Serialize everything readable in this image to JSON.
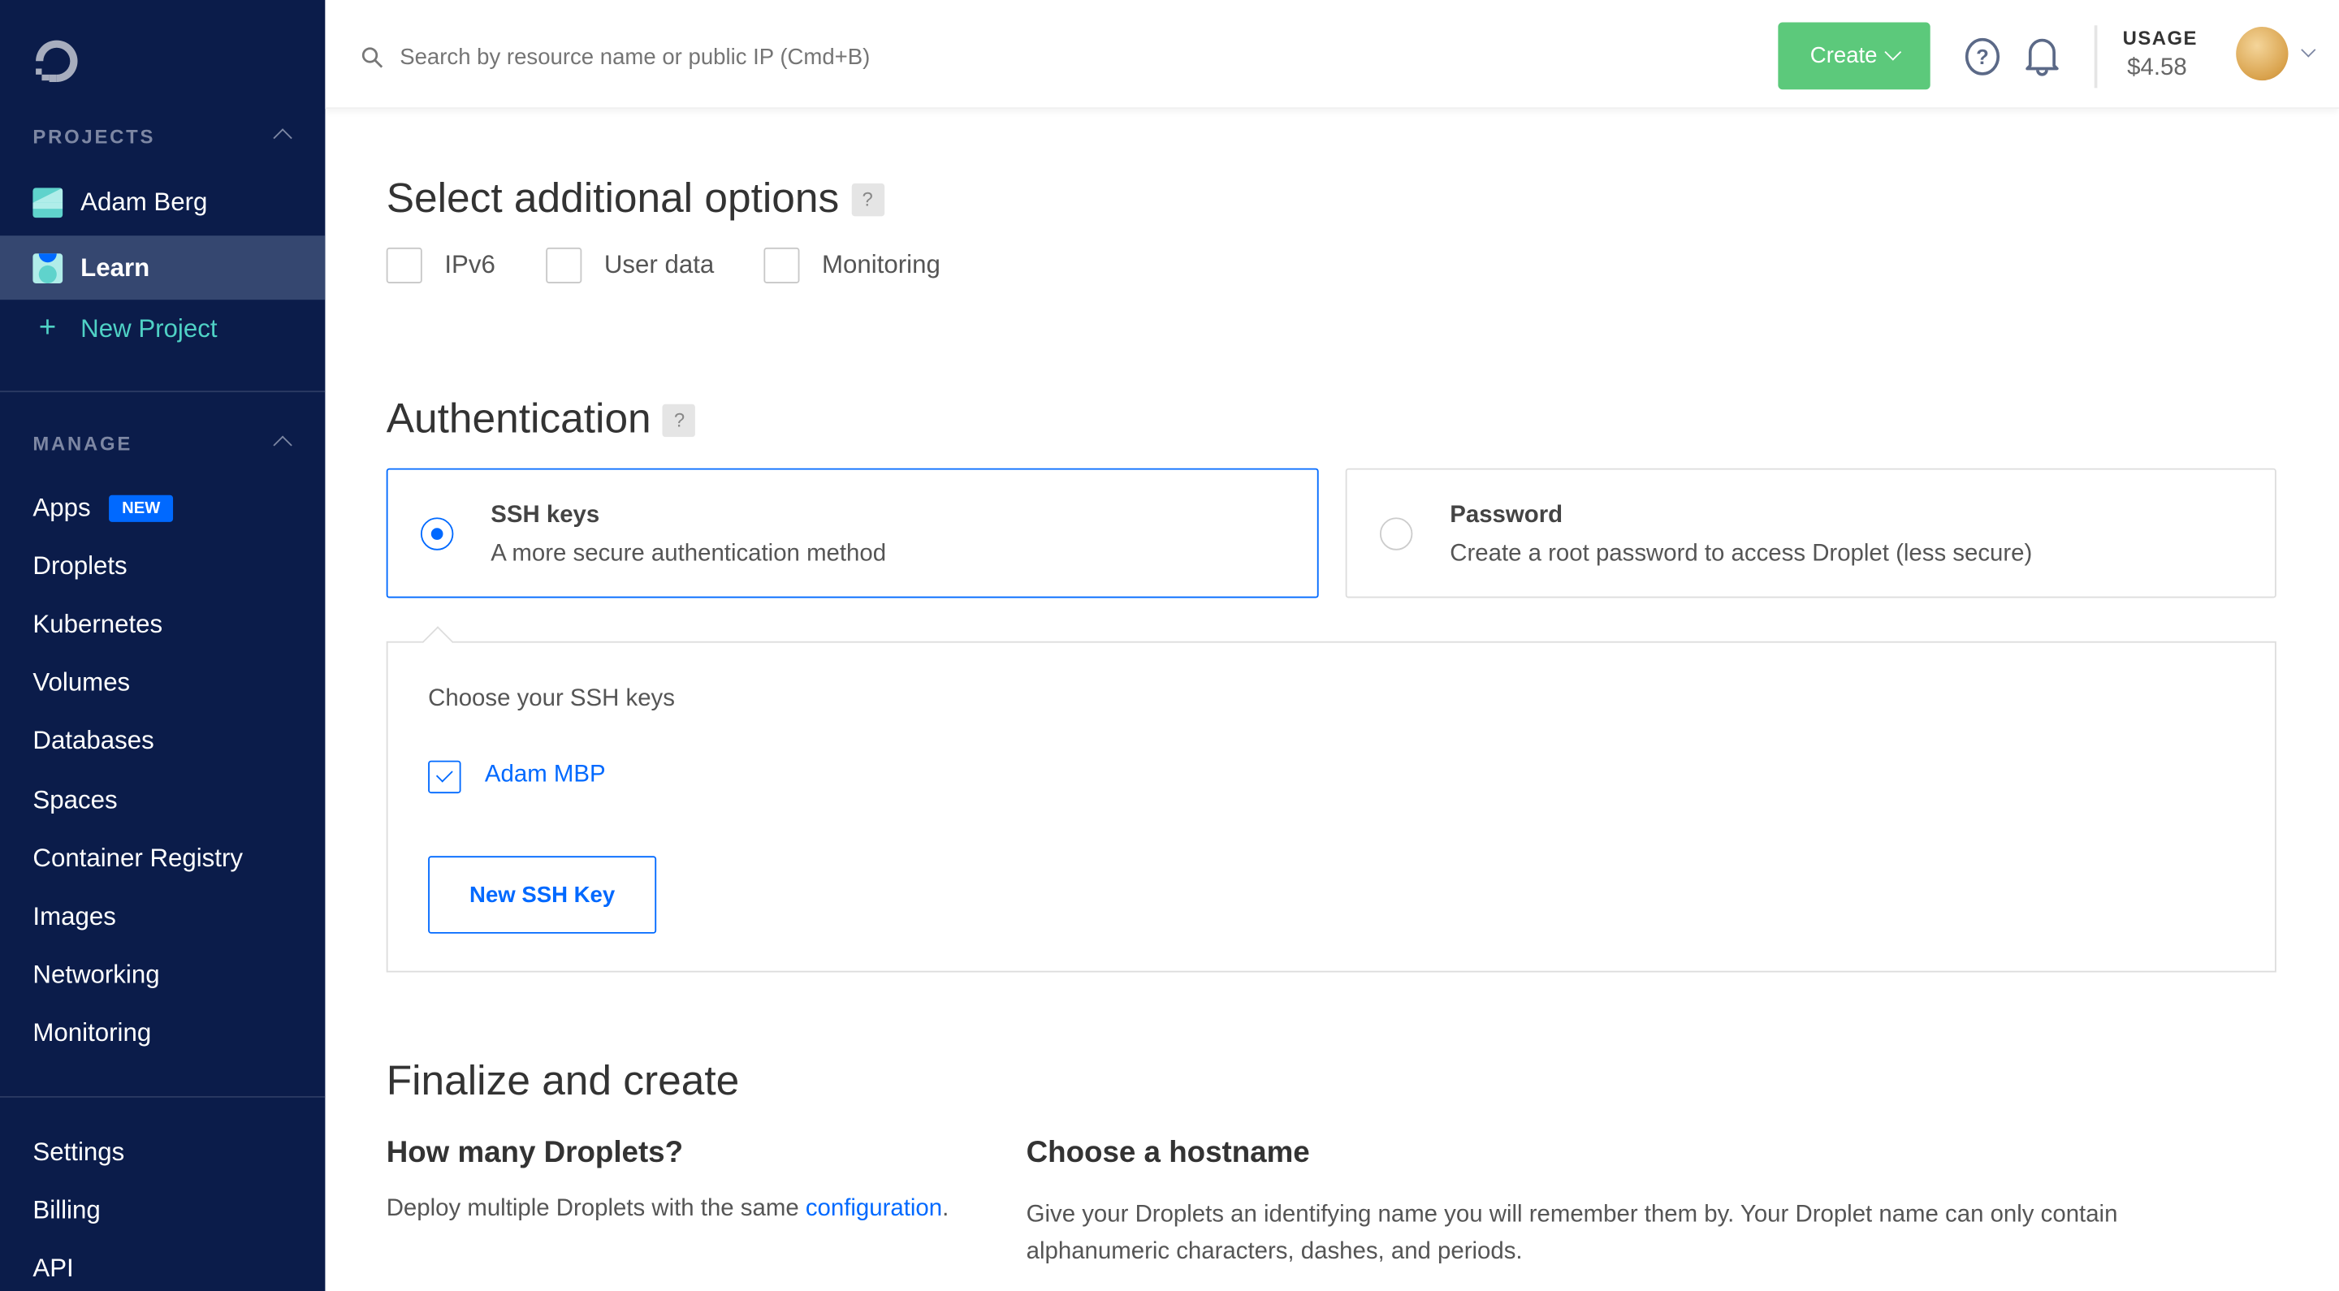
{
  "sidebar": {
    "projects_header": "PROJECTS",
    "projects": [
      {
        "label": "Adam Berg"
      },
      {
        "label": "Learn"
      }
    ],
    "new_project": "New Project",
    "manage_header": "MANAGE",
    "manage": [
      {
        "label": "Apps",
        "badge": "NEW"
      },
      {
        "label": "Droplets"
      },
      {
        "label": "Kubernetes"
      },
      {
        "label": "Volumes"
      },
      {
        "label": "Databases"
      },
      {
        "label": "Spaces"
      },
      {
        "label": "Container Registry"
      },
      {
        "label": "Images"
      },
      {
        "label": "Networking"
      },
      {
        "label": "Monitoring"
      }
    ],
    "bottom": [
      {
        "label": "Settings"
      },
      {
        "label": "Billing"
      },
      {
        "label": "API"
      }
    ]
  },
  "header": {
    "search_placeholder": "Search by resource name or public IP (Cmd+B)",
    "create": "Create",
    "usage_label": "USAGE",
    "usage_value": "$4.58"
  },
  "options": {
    "title": "Select additional options",
    "help": "?",
    "items": [
      {
        "label": "IPv6",
        "checked": false
      },
      {
        "label": "User data",
        "checked": false
      },
      {
        "label": "Monitoring",
        "checked": false
      }
    ]
  },
  "auth": {
    "title": "Authentication",
    "help": "?",
    "methods": [
      {
        "title": "SSH keys",
        "desc": "A more secure authentication method",
        "selected": true
      },
      {
        "title": "Password",
        "desc": "Create a root password to access Droplet (less secure)",
        "selected": false
      }
    ],
    "choose_label": "Choose your SSH keys",
    "keys": [
      {
        "label": "Adam MBP",
        "checked": true
      }
    ],
    "new_key": "New SSH Key"
  },
  "finalize": {
    "title": "Finalize and create",
    "count_title": "How many Droplets?",
    "count_desc": "Deploy multiple Droplets with the same ",
    "count_link": "configuration",
    "count_end": ".",
    "host_title": "Choose a hostname",
    "host_desc": "Give your Droplets an identifying name you will remember them by. Your Droplet name can only contain alphanumeric characters, dashes, and periods."
  },
  "colors": {
    "sidebar": "#0b1c4a",
    "accent": "#0069ff",
    "create": "#5cc97b",
    "teal": "#4fd1c5"
  }
}
